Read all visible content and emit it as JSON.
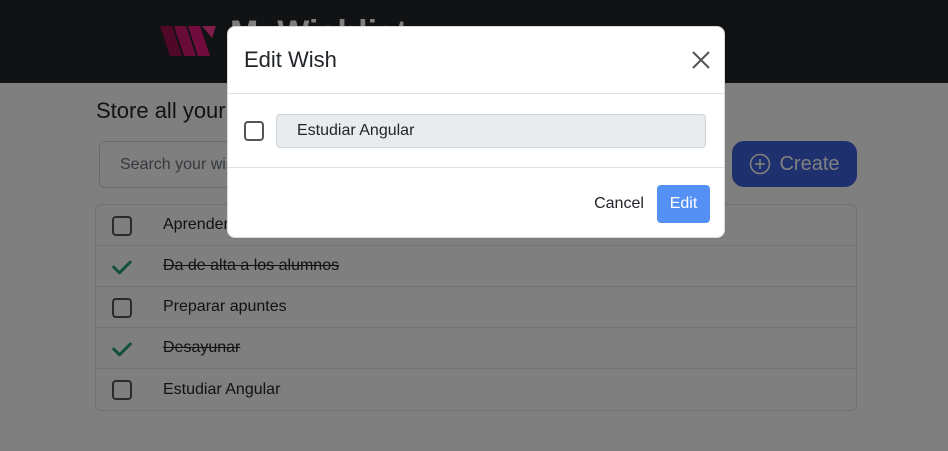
{
  "header": {
    "brand": "MyWishlist",
    "logo_icon": "wishlist-logo-icon",
    "logo_color": "#e5197f"
  },
  "main": {
    "tagline": "Store all your wishes",
    "search_placeholder": "Search your wishes",
    "create_label": "Create",
    "create_icon": "plus-circle-icon",
    "accent": "#3d63dd"
  },
  "wishes": [
    {
      "text": "Aprender",
      "done": false
    },
    {
      "text": "Da de alta a los alumnos",
      "done": true
    },
    {
      "text": "Preparar apuntes",
      "done": false
    },
    {
      "text": "Desayunar",
      "done": true
    },
    {
      "text": "Estudiar Angular",
      "done": false
    }
  ],
  "modal": {
    "title": "Edit Wish",
    "close_icon": "close-icon",
    "checkbox_checked": false,
    "input_value": "Estudiar Angular",
    "cancel_label": "Cancel",
    "edit_label": "Edit",
    "done_color": "#20a070"
  }
}
